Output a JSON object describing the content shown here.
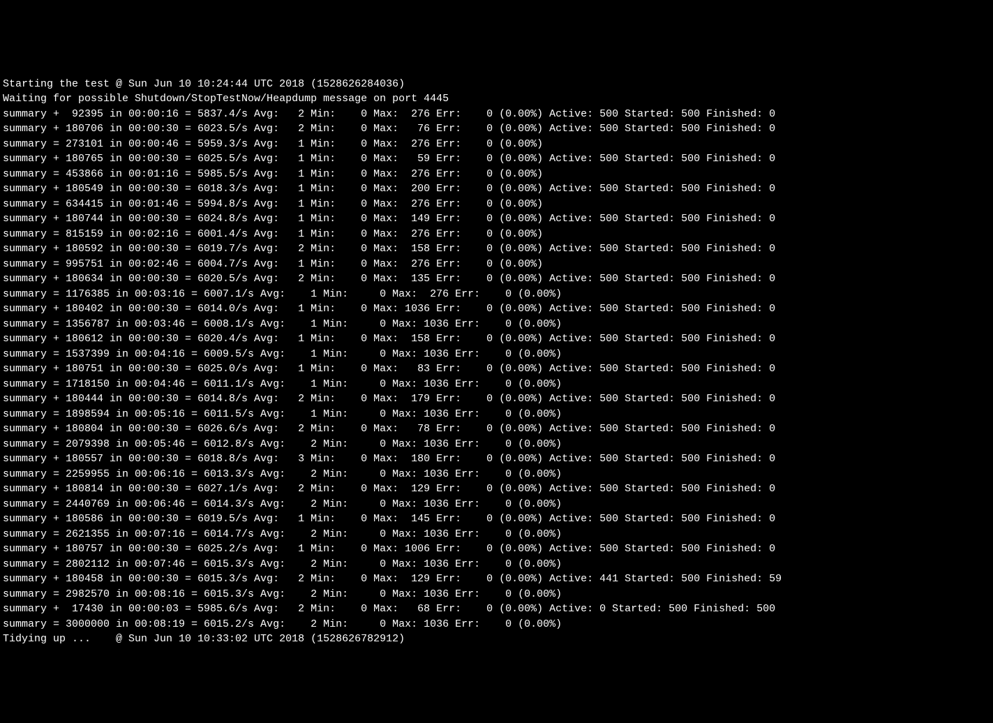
{
  "header1": "Starting the test @ Sun Jun 10 10:24:44 UTC 2018 (1528626284036)",
  "header2": "Waiting for possible Shutdown/StopTestNow/Heapdump message on port 4445",
  "footer": "Tidying up ...    @ Sun Jun 10 10:33:02 UTC 2018 (1528626782912)",
  "rows": [
    {
      "op": "+",
      "count": 92395,
      "dur": "00:00:16",
      "rate": "5837.4",
      "avg": 2,
      "min": 0,
      "max": 276,
      "err": 0,
      "pct": "0.00%",
      "active": 500,
      "started": 500,
      "finished": 0
    },
    {
      "op": "+",
      "count": 180706,
      "dur": "00:00:30",
      "rate": "6023.5",
      "avg": 2,
      "min": 0,
      "max": 76,
      "err": 0,
      "pct": "0.00%",
      "active": 500,
      "started": 500,
      "finished": 0
    },
    {
      "op": "=",
      "count": 273101,
      "dur": "00:00:46",
      "rate": "5959.3",
      "avg": 1,
      "min": 0,
      "max": 276,
      "err": 0,
      "pct": "0.00%"
    },
    {
      "op": "+",
      "count": 180765,
      "dur": "00:00:30",
      "rate": "6025.5",
      "avg": 1,
      "min": 0,
      "max": 59,
      "err": 0,
      "pct": "0.00%",
      "active": 500,
      "started": 500,
      "finished": 0
    },
    {
      "op": "=",
      "count": 453866,
      "dur": "00:01:16",
      "rate": "5985.5",
      "avg": 1,
      "min": 0,
      "max": 276,
      "err": 0,
      "pct": "0.00%"
    },
    {
      "op": "+",
      "count": 180549,
      "dur": "00:00:30",
      "rate": "6018.3",
      "avg": 1,
      "min": 0,
      "max": 200,
      "err": 0,
      "pct": "0.00%",
      "active": 500,
      "started": 500,
      "finished": 0
    },
    {
      "op": "=",
      "count": 634415,
      "dur": "00:01:46",
      "rate": "5994.8",
      "avg": 1,
      "min": 0,
      "max": 276,
      "err": 0,
      "pct": "0.00%"
    },
    {
      "op": "+",
      "count": 180744,
      "dur": "00:00:30",
      "rate": "6024.8",
      "avg": 1,
      "min": 0,
      "max": 149,
      "err": 0,
      "pct": "0.00%",
      "active": 500,
      "started": 500,
      "finished": 0
    },
    {
      "op": "=",
      "count": 815159,
      "dur": "00:02:16",
      "rate": "6001.4",
      "avg": 1,
      "min": 0,
      "max": 276,
      "err": 0,
      "pct": "0.00%"
    },
    {
      "op": "+",
      "count": 180592,
      "dur": "00:00:30",
      "rate": "6019.7",
      "avg": 2,
      "min": 0,
      "max": 158,
      "err": 0,
      "pct": "0.00%",
      "active": 500,
      "started": 500,
      "finished": 0
    },
    {
      "op": "=",
      "count": 995751,
      "dur": "00:02:46",
      "rate": "6004.7",
      "avg": 1,
      "min": 0,
      "max": 276,
      "err": 0,
      "pct": "0.00%"
    },
    {
      "op": "+",
      "count": 180634,
      "dur": "00:00:30",
      "rate": "6020.5",
      "avg": 2,
      "min": 0,
      "max": 135,
      "err": 0,
      "pct": "0.00%",
      "active": 500,
      "started": 500,
      "finished": 0
    },
    {
      "op": "=",
      "count": 1176385,
      "dur": "00:03:16",
      "rate": "6007.1",
      "avg": 1,
      "min": 0,
      "max": 276,
      "err": 0,
      "pct": "0.00%"
    },
    {
      "op": "+",
      "count": 180402,
      "dur": "00:00:30",
      "rate": "6014.0",
      "avg": 1,
      "min": 0,
      "max": 1036,
      "err": 0,
      "pct": "0.00%",
      "active": 500,
      "started": 500,
      "finished": 0
    },
    {
      "op": "=",
      "count": 1356787,
      "dur": "00:03:46",
      "rate": "6008.1",
      "avg": 1,
      "min": 0,
      "max": 1036,
      "err": 0,
      "pct": "0.00%"
    },
    {
      "op": "+",
      "count": 180612,
      "dur": "00:00:30",
      "rate": "6020.4",
      "avg": 1,
      "min": 0,
      "max": 158,
      "err": 0,
      "pct": "0.00%",
      "active": 500,
      "started": 500,
      "finished": 0
    },
    {
      "op": "=",
      "count": 1537399,
      "dur": "00:04:16",
      "rate": "6009.5",
      "avg": 1,
      "min": 0,
      "max": 1036,
      "err": 0,
      "pct": "0.00%"
    },
    {
      "op": "+",
      "count": 180751,
      "dur": "00:00:30",
      "rate": "6025.0",
      "avg": 1,
      "min": 0,
      "max": 83,
      "err": 0,
      "pct": "0.00%",
      "active": 500,
      "started": 500,
      "finished": 0
    },
    {
      "op": "=",
      "count": 1718150,
      "dur": "00:04:46",
      "rate": "6011.1",
      "avg": 1,
      "min": 0,
      "max": 1036,
      "err": 0,
      "pct": "0.00%"
    },
    {
      "op": "+",
      "count": 180444,
      "dur": "00:00:30",
      "rate": "6014.8",
      "avg": 2,
      "min": 0,
      "max": 179,
      "err": 0,
      "pct": "0.00%",
      "active": 500,
      "started": 500,
      "finished": 0
    },
    {
      "op": "=",
      "count": 1898594,
      "dur": "00:05:16",
      "rate": "6011.5",
      "avg": 1,
      "min": 0,
      "max": 1036,
      "err": 0,
      "pct": "0.00%"
    },
    {
      "op": "+",
      "count": 180804,
      "dur": "00:00:30",
      "rate": "6026.6",
      "avg": 2,
      "min": 0,
      "max": 78,
      "err": 0,
      "pct": "0.00%",
      "active": 500,
      "started": 500,
      "finished": 0
    },
    {
      "op": "=",
      "count": 2079398,
      "dur": "00:05:46",
      "rate": "6012.8",
      "avg": 2,
      "min": 0,
      "max": 1036,
      "err": 0,
      "pct": "0.00%"
    },
    {
      "op": "+",
      "count": 180557,
      "dur": "00:00:30",
      "rate": "6018.8",
      "avg": 3,
      "min": 0,
      "max": 180,
      "err": 0,
      "pct": "0.00%",
      "active": 500,
      "started": 500,
      "finished": 0
    },
    {
      "op": "=",
      "count": 2259955,
      "dur": "00:06:16",
      "rate": "6013.3",
      "avg": 2,
      "min": 0,
      "max": 1036,
      "err": 0,
      "pct": "0.00%"
    },
    {
      "op": "+",
      "count": 180814,
      "dur": "00:00:30",
      "rate": "6027.1",
      "avg": 2,
      "min": 0,
      "max": 129,
      "err": 0,
      "pct": "0.00%",
      "active": 500,
      "started": 500,
      "finished": 0
    },
    {
      "op": "=",
      "count": 2440769,
      "dur": "00:06:46",
      "rate": "6014.3",
      "avg": 2,
      "min": 0,
      "max": 1036,
      "err": 0,
      "pct": "0.00%"
    },
    {
      "op": "+",
      "count": 180586,
      "dur": "00:00:30",
      "rate": "6019.5",
      "avg": 1,
      "min": 0,
      "max": 145,
      "err": 0,
      "pct": "0.00%",
      "active": 500,
      "started": 500,
      "finished": 0
    },
    {
      "op": "=",
      "count": 2621355,
      "dur": "00:07:16",
      "rate": "6014.7",
      "avg": 2,
      "min": 0,
      "max": 1036,
      "err": 0,
      "pct": "0.00%"
    },
    {
      "op": "+",
      "count": 180757,
      "dur": "00:00:30",
      "rate": "6025.2",
      "avg": 1,
      "min": 0,
      "max": 1006,
      "err": 0,
      "pct": "0.00%",
      "active": 500,
      "started": 500,
      "finished": 0
    },
    {
      "op": "=",
      "count": 2802112,
      "dur": "00:07:46",
      "rate": "6015.3",
      "avg": 2,
      "min": 0,
      "max": 1036,
      "err": 0,
      "pct": "0.00%"
    },
    {
      "op": "+",
      "count": 180458,
      "dur": "00:00:30",
      "rate": "6015.3",
      "avg": 2,
      "min": 0,
      "max": 129,
      "err": 0,
      "pct": "0.00%",
      "active": 441,
      "started": 500,
      "finished": 59
    },
    {
      "op": "=",
      "count": 2982570,
      "dur": "00:08:16",
      "rate": "6015.3",
      "avg": 2,
      "min": 0,
      "max": 1036,
      "err": 0,
      "pct": "0.00%"
    },
    {
      "op": "+",
      "count": 17430,
      "dur": "00:00:03",
      "rate": "5985.6",
      "avg": 2,
      "min": 0,
      "max": 68,
      "err": 0,
      "pct": "0.00%",
      "active": 0,
      "started": 500,
      "finished": 500
    },
    {
      "op": "=",
      "count": 3000000,
      "dur": "00:08:19",
      "rate": "6015.2",
      "avg": 2,
      "min": 0,
      "max": 1036,
      "err": 0,
      "pct": "0.00%"
    }
  ]
}
